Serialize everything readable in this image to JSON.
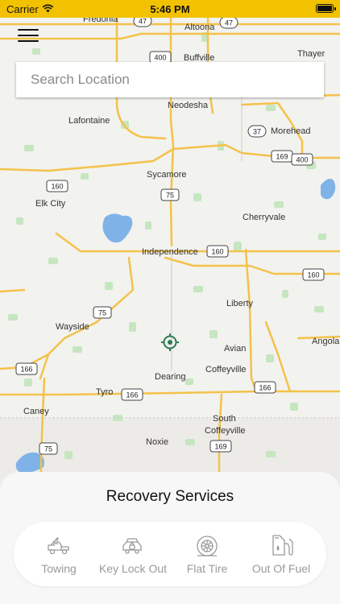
{
  "status_bar": {
    "carrier": "Carrier",
    "time": "5:46 PM"
  },
  "search": {
    "placeholder": "Search Location"
  },
  "map": {
    "towns": [
      "Fredonia",
      "Altoona",
      "Buffville",
      "Thayer",
      "Neodesha",
      "Lafontaine",
      "Morehead",
      "Sycamore",
      "Elk City",
      "Cherryvale",
      "Independence",
      "Liberty",
      "Wayside",
      "Avian",
      "Angola",
      "Dearing",
      "Tyro",
      "Coffeyville",
      "Caney",
      "South",
      "Coffeyville",
      "Noxie"
    ],
    "shields": [
      "47",
      "47",
      "400",
      "37",
      "169",
      "400",
      "160",
      "75",
      "160",
      "160",
      "75",
      "166",
      "166",
      "166",
      "169",
      "75"
    ]
  },
  "sheet": {
    "title": "Recovery Services",
    "services": [
      {
        "label": "Towing",
        "icon": "tow-truck-icon"
      },
      {
        "label": "Key Lock Out",
        "icon": "car-lock-icon"
      },
      {
        "label": "Flat Tire",
        "icon": "tire-icon"
      },
      {
        "label": "Out Of Fuel",
        "icon": "fuel-pump-icon"
      }
    ]
  },
  "colors": {
    "status_bar": "#f2c200",
    "road": "#f4c24a",
    "water": "#7fb3e8",
    "park": "#c6e6c0",
    "accent": "#2e7d4f"
  }
}
